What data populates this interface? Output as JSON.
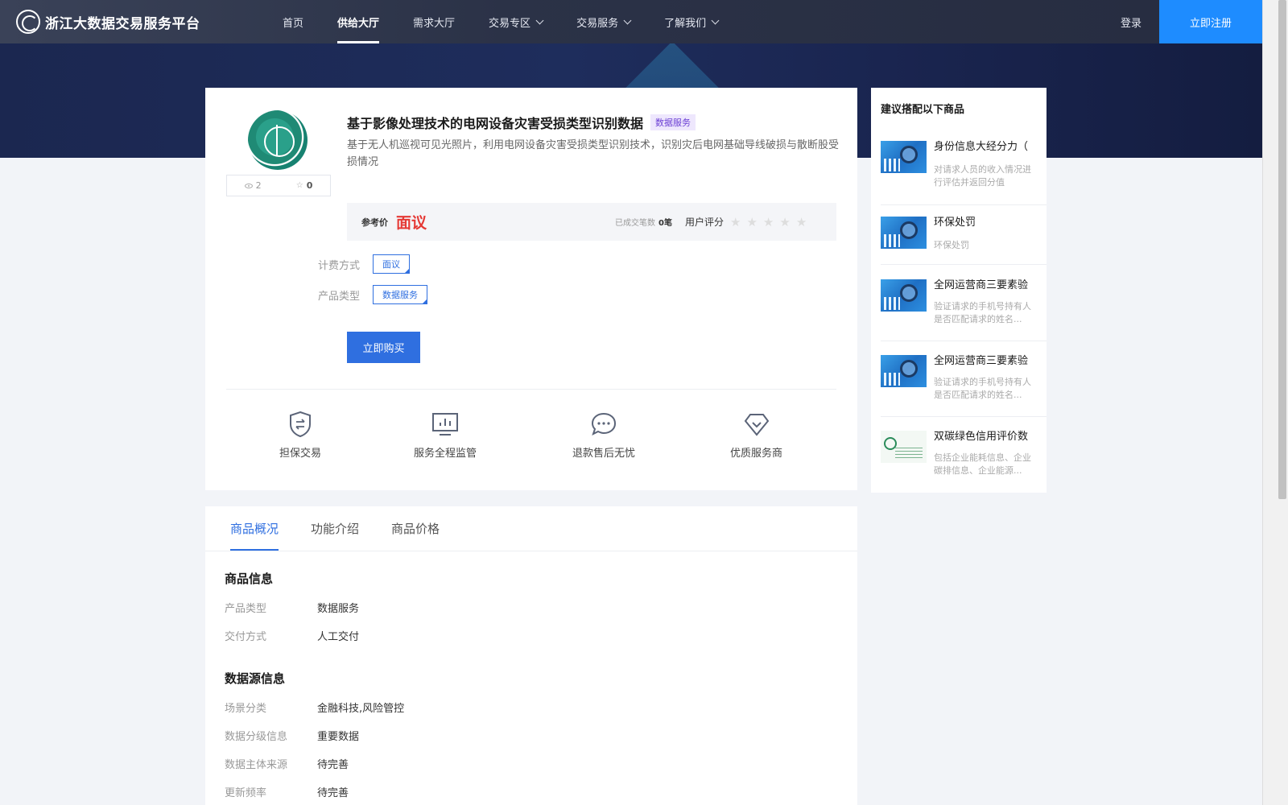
{
  "header": {
    "logo_text": "浙江大数据交易服务平台",
    "nav": [
      {
        "label": "首页",
        "active": false,
        "dropdown": false
      },
      {
        "label": "供给大厅",
        "active": true,
        "dropdown": false
      },
      {
        "label": "需求大厅",
        "active": false,
        "dropdown": false
      },
      {
        "label": "交易专区",
        "active": false,
        "dropdown": true
      },
      {
        "label": "交易服务",
        "active": false,
        "dropdown": true
      },
      {
        "label": "了解我们",
        "active": false,
        "dropdown": true
      }
    ],
    "login": "登录",
    "register": "立即注册"
  },
  "product": {
    "title": "基于影像处理技术的电网设备灾害受损类型识别数据",
    "type_tag": "数据服务",
    "description": "基于无人机巡视可见光照片，利用电网设备灾害受损类型识别技术，识别灾后电网基础导线破损与散断股受损情况",
    "views": "2",
    "favorites": "0",
    "price_label": "参考价",
    "price_value": "面议",
    "deals_label": "已成交笔数",
    "deals_value": "0笔",
    "rating_label": "用户评分",
    "rating": 0,
    "billing_label": "计费方式",
    "billing_value": "面议",
    "category_label": "产品类型",
    "category_value": "数据服务",
    "buy_button": "立即购买"
  },
  "features": [
    {
      "label": "担保交易",
      "icon": "shield-swap-icon"
    },
    {
      "label": "服务全程监管",
      "icon": "monitor-chart-icon"
    },
    {
      "label": "退款售后无忧",
      "icon": "chat-bubble-icon"
    },
    {
      "label": "优质服务商",
      "icon": "diamond-icon"
    }
  ],
  "tabs": [
    {
      "label": "商品概况",
      "active": true
    },
    {
      "label": "功能介绍",
      "active": false
    },
    {
      "label": "商品价格",
      "active": false
    }
  ],
  "sections": {
    "product_info": {
      "title": "商品信息",
      "rows": [
        {
          "k": "产品类型",
          "v": "数据服务"
        },
        {
          "k": "交付方式",
          "v": "人工交付"
        }
      ]
    },
    "source_info": {
      "title": "数据源信息",
      "rows": [
        {
          "k": "场景分类",
          "v": "金融科技,风险管控"
        },
        {
          "k": "数据分级信息",
          "v": "重要数据"
        },
        {
          "k": "数据主体来源",
          "v": "待完善"
        },
        {
          "k": "更新频率",
          "v": "待完善"
        }
      ]
    }
  },
  "sidebar": {
    "title": "建议搭配以下商品",
    "items": [
      {
        "name": "身份信息大经分力（",
        "desc": "对请求人员的收入情况进行评估并返回分值"
      },
      {
        "name": "环保处罚",
        "desc": "环保处罚"
      },
      {
        "name": "全网运营商三要素验",
        "desc": "验证请求的手机号持有人是否匹配请求的姓名..."
      },
      {
        "name": "全网运营商三要素验",
        "desc": "验证请求的手机号持有人是否匹配请求的姓名..."
      },
      {
        "name": "双碳绿色信用评价数",
        "desc": "包括企业能耗信息、企业碳排信息、企业能源..."
      }
    ]
  },
  "colors": {
    "accent": "#2f6fe0",
    "register": "#1e8cff",
    "price": "#e53935",
    "nav_bg": "#2b3247"
  }
}
